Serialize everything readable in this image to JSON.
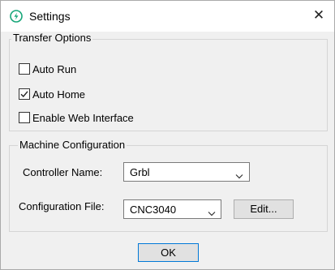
{
  "window": {
    "title": "Settings",
    "app_icon": "power-icon",
    "close_glyph": "✕"
  },
  "transfer_options": {
    "title": "Transfer Options",
    "options": [
      {
        "label": "Auto Run",
        "checked": false
      },
      {
        "label": "Auto Home",
        "checked": true
      },
      {
        "label": "Enable Web Interface",
        "checked": false
      }
    ]
  },
  "machine_configuration": {
    "title": "Machine Configuration",
    "controller_label": "Controller Name:",
    "controller_value": "Grbl",
    "config_file_label": "Configuration File:",
    "config_file_value": "CNC3040",
    "edit_label": "Edit..."
  },
  "footer": {
    "ok_label": "OK"
  },
  "colors": {
    "accent": "#0078d7",
    "app_icon": "#17a679"
  }
}
